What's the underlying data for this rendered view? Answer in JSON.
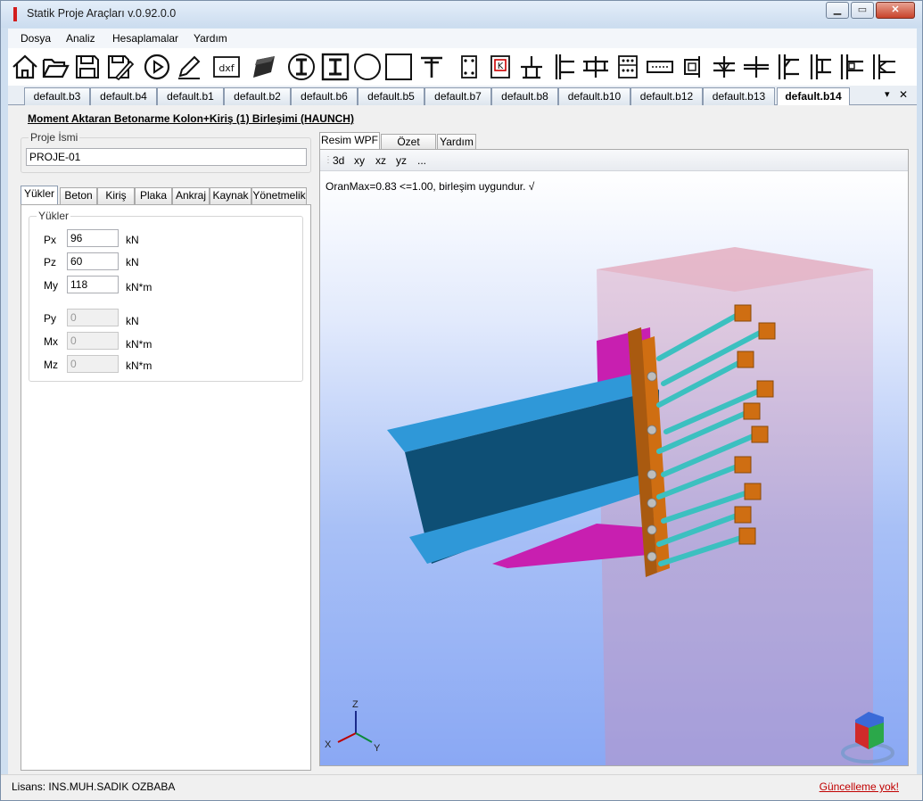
{
  "window": {
    "title": "Statik Proje Araçları v.0.92.0.0",
    "min_label": "▁",
    "max_label": "▭",
    "close_label": "✕"
  },
  "menu": [
    "Dosya",
    "Analiz",
    "Hesaplamalar",
    "Yardım"
  ],
  "toolbar": {
    "icons": [
      "home-icon",
      "open-folder-icon",
      "save-icon",
      "save-as-icon",
      "run-icon",
      "edit-icon",
      "dxf-icon",
      "material-icon",
      "i-beam-circle-icon",
      "i-beam-square-icon",
      "circle-section-icon",
      "square-section-icon",
      "t-beam-icon",
      "column-base-icon",
      "k-brace-icon",
      "beam-column-icon",
      "column-splice-icon",
      "beam-splice-icon",
      "base-plate-icon",
      "stiffened-plate-icon",
      "end-plate-icon",
      "flange-plate-icon",
      "beam-to-beam-icon",
      "shear-tab-icon",
      "moment-end-icon",
      "haunch-icon",
      "extended-end-icon",
      "bolt-group-icon",
      "double-column-icon"
    ],
    "dxf_label": "dxf"
  },
  "doc_tabs": [
    "default.b3",
    "default.b4",
    "default.b1",
    "default.b2",
    "default.b6",
    "default.b5",
    "default.b7",
    "default.b8",
    "default.b10",
    "default.b12",
    "default.b13",
    "default.b14"
  ],
  "active_doc_tab": "default.b14",
  "tabstrip_menu": "▾",
  "tabstrip_close": "✕",
  "page_title": "Moment Aktaran Betonarme Kolon+Kiriş (1) Birleşimi (HAUNCH)",
  "project": {
    "label": "Proje İsmi",
    "value": "PROJE-01"
  },
  "left_tabs": [
    "Yükler",
    "Beton",
    "Kiriş",
    "Plaka",
    "Ankraj",
    "Kaynak",
    "Yönetmelik"
  ],
  "loads": {
    "group_label": "Yükler",
    "rows": [
      {
        "label": "Px",
        "value": "96",
        "unit": "kN",
        "enabled": true
      },
      {
        "label": "Pz",
        "value": "60",
        "unit": "kN",
        "enabled": true
      },
      {
        "label": "My",
        "value": "118",
        "unit": "kN*m",
        "enabled": true
      },
      {
        "label": "Py",
        "value": "0",
        "unit": "kN",
        "enabled": false
      },
      {
        "label": "Mx",
        "value": "0",
        "unit": "kN*m",
        "enabled": false
      },
      {
        "label": "Mz",
        "value": "0",
        "unit": "kN*m",
        "enabled": false
      }
    ]
  },
  "right_tabs": [
    "Resim WPF",
    "Özet Rapor",
    "Yardım"
  ],
  "view_buttons": [
    "3d",
    "xy",
    "xz",
    "yz",
    "..."
  ],
  "ratio_text": "OranMax=0.83 <=1.00, birleşim uygundur. √",
  "axes": {
    "z": "Z",
    "x": "X",
    "y": "Y"
  },
  "status": {
    "license": "Lisans: INS.MUH.SADIK OZBABA",
    "update": "Güncelleme yok!"
  },
  "colors": {
    "beam": "#2f98d8",
    "beam_dark": "#0e4f75",
    "haunch": "#c81fb0",
    "endplate": "#cf6e12",
    "bolt": "#3cc0c0",
    "column": "#e6a3b4"
  }
}
